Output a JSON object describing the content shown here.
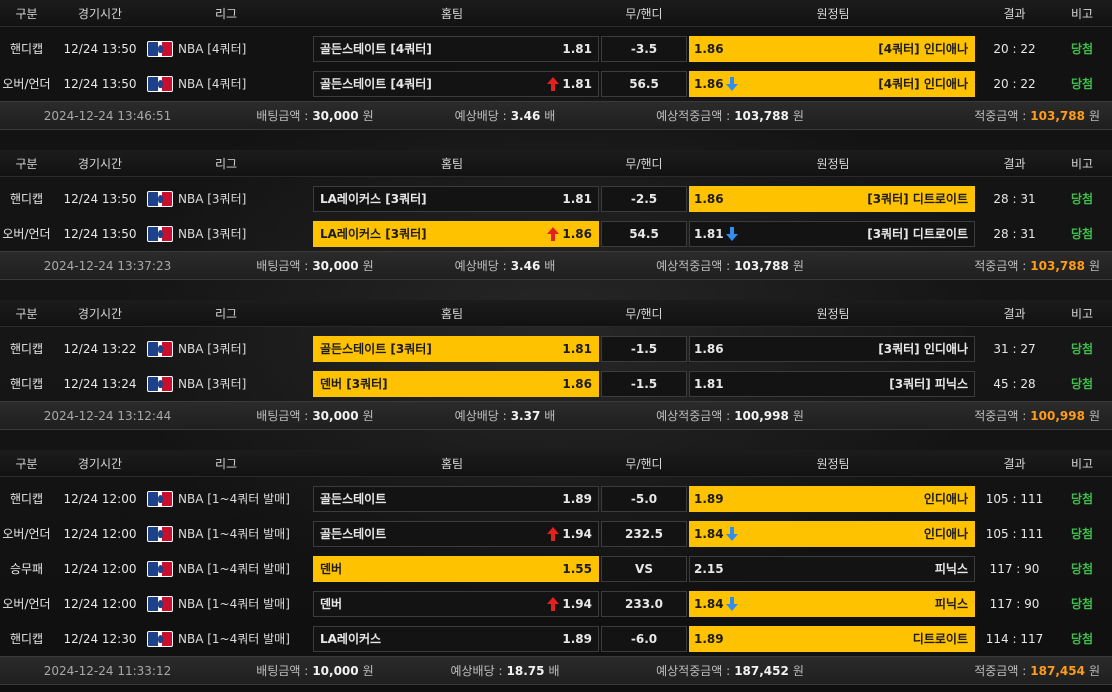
{
  "headers": {
    "type": "구분",
    "time": "경기시간",
    "league": "리그",
    "home": "홈팀",
    "handicap": "무/핸디",
    "away": "원정팀",
    "result": "결과",
    "note": "비고"
  },
  "colors": {
    "selected": "#ffc200",
    "win": "#3fbf4a",
    "payout": "#ff9c1a",
    "arrow_up": "#e52020",
    "arrow_down": "#2f8ef0"
  },
  "labels": {
    "bet_amount": "배팅금액 :",
    "expected_odds": "예상배당 :",
    "expected_payout": "예상적중금액 :",
    "won_amount": "적중금액 :",
    "won_unit": "원",
    "odds_unit": "배"
  },
  "slips": [
    {
      "rows": [
        {
          "type": "핸디캡",
          "time": "12/24 13:50",
          "league": "NBA [4쿼터]",
          "home": "골든스테이트 [4쿼터]",
          "home_odds": "1.81",
          "handicap": "-3.5",
          "away_odds": "1.86",
          "away": "[4쿼터] 인디애나",
          "result": "20 : 22",
          "note": "당첨",
          "selected": "away",
          "home_arrow": "",
          "away_arrow": ""
        },
        {
          "type": "오버/언더",
          "time": "12/24 13:50",
          "league": "NBA [4쿼터]",
          "home": "골든스테이트 [4쿼터]",
          "home_odds": "1.81",
          "handicap": "56.5",
          "away_odds": "1.86",
          "away": "[4쿼터] 인디애나",
          "result": "20 : 22",
          "note": "당첨",
          "selected": "away",
          "home_arrow": "up",
          "away_arrow": "down"
        }
      ],
      "date": "2024-12-24 13:46:51",
      "bet": "30,000",
      "odds": "3.46",
      "expected": "103,788",
      "won": "103,788"
    },
    {
      "rows": [
        {
          "type": "핸디캡",
          "time": "12/24 13:50",
          "league": "NBA [3쿼터]",
          "home": "LA레이커스 [3쿼터]",
          "home_odds": "1.81",
          "handicap": "-2.5",
          "away_odds": "1.86",
          "away": "[3쿼터] 디트로이트",
          "result": "28 : 31",
          "note": "당첨",
          "selected": "away",
          "home_arrow": "",
          "away_arrow": ""
        },
        {
          "type": "오버/언더",
          "time": "12/24 13:50",
          "league": "NBA [3쿼터]",
          "home": "LA레이커스 [3쿼터]",
          "home_odds": "1.86",
          "handicap": "54.5",
          "away_odds": "1.81",
          "away": "[3쿼터] 디트로이트",
          "result": "28 : 31",
          "note": "당첨",
          "selected": "home",
          "home_arrow": "up",
          "away_arrow": "down"
        }
      ],
      "date": "2024-12-24 13:37:23",
      "bet": "30,000",
      "odds": "3.46",
      "expected": "103,788",
      "won": "103,788"
    },
    {
      "rows": [
        {
          "type": "핸디캡",
          "time": "12/24 13:22",
          "league": "NBA [3쿼터]",
          "home": "골든스테이트 [3쿼터]",
          "home_odds": "1.81",
          "handicap": "-1.5",
          "away_odds": "1.86",
          "away": "[3쿼터] 인디애나",
          "result": "31 : 27",
          "note": "당첨",
          "selected": "home",
          "home_arrow": "",
          "away_arrow": ""
        },
        {
          "type": "핸디캡",
          "time": "12/24 13:24",
          "league": "NBA [3쿼터]",
          "home": "덴버 [3쿼터]",
          "home_odds": "1.86",
          "handicap": "-1.5",
          "away_odds": "1.81",
          "away": "[3쿼터] 피닉스",
          "result": "45 : 28",
          "note": "당첨",
          "selected": "home",
          "home_arrow": "",
          "away_arrow": ""
        }
      ],
      "date": "2024-12-24 13:12:44",
      "bet": "30,000",
      "odds": "3.37",
      "expected": "100,998",
      "won": "100,998"
    },
    {
      "rows": [
        {
          "type": "핸디캡",
          "time": "12/24 12:00",
          "league": "NBA [1~4쿼터 발매]",
          "home": "골든스테이트",
          "home_odds": "1.89",
          "handicap": "-5.0",
          "away_odds": "1.89",
          "away": "인디애나",
          "result": "105 : 111",
          "note": "당첨",
          "selected": "away",
          "home_arrow": "",
          "away_arrow": ""
        },
        {
          "type": "오버/언더",
          "time": "12/24 12:00",
          "league": "NBA [1~4쿼터 발매]",
          "home": "골든스테이트",
          "home_odds": "1.94",
          "handicap": "232.5",
          "away_odds": "1.84",
          "away": "인디애나",
          "result": "105 : 111",
          "note": "당첨",
          "selected": "away",
          "home_arrow": "up",
          "away_arrow": "down"
        },
        {
          "type": "승무패",
          "time": "12/24 12:00",
          "league": "NBA [1~4쿼터 발매]",
          "home": "덴버",
          "home_odds": "1.55",
          "handicap": "VS",
          "away_odds": "2.15",
          "away": "피닉스",
          "result": "117 : 90",
          "note": "당첨",
          "selected": "home",
          "home_arrow": "",
          "away_arrow": ""
        },
        {
          "type": "오버/언더",
          "time": "12/24 12:00",
          "league": "NBA [1~4쿼터 발매]",
          "home": "덴버",
          "home_odds": "1.94",
          "handicap": "233.0",
          "away_odds": "1.84",
          "away": "피닉스",
          "result": "117 : 90",
          "note": "당첨",
          "selected": "away",
          "home_arrow": "up",
          "away_arrow": "down"
        },
        {
          "type": "핸디캡",
          "time": "12/24 12:30",
          "league": "NBA [1~4쿼터 발매]",
          "home": "LA레이커스",
          "home_odds": "1.89",
          "handicap": "-6.0",
          "away_odds": "1.89",
          "away": "디트로이트",
          "result": "114 : 117",
          "note": "당첨",
          "selected": "away",
          "home_arrow": "",
          "away_arrow": ""
        }
      ],
      "date": "2024-12-24 11:33:12",
      "bet": "10,000",
      "odds": "18.75",
      "expected": "187,452",
      "won": "187,454"
    }
  ]
}
